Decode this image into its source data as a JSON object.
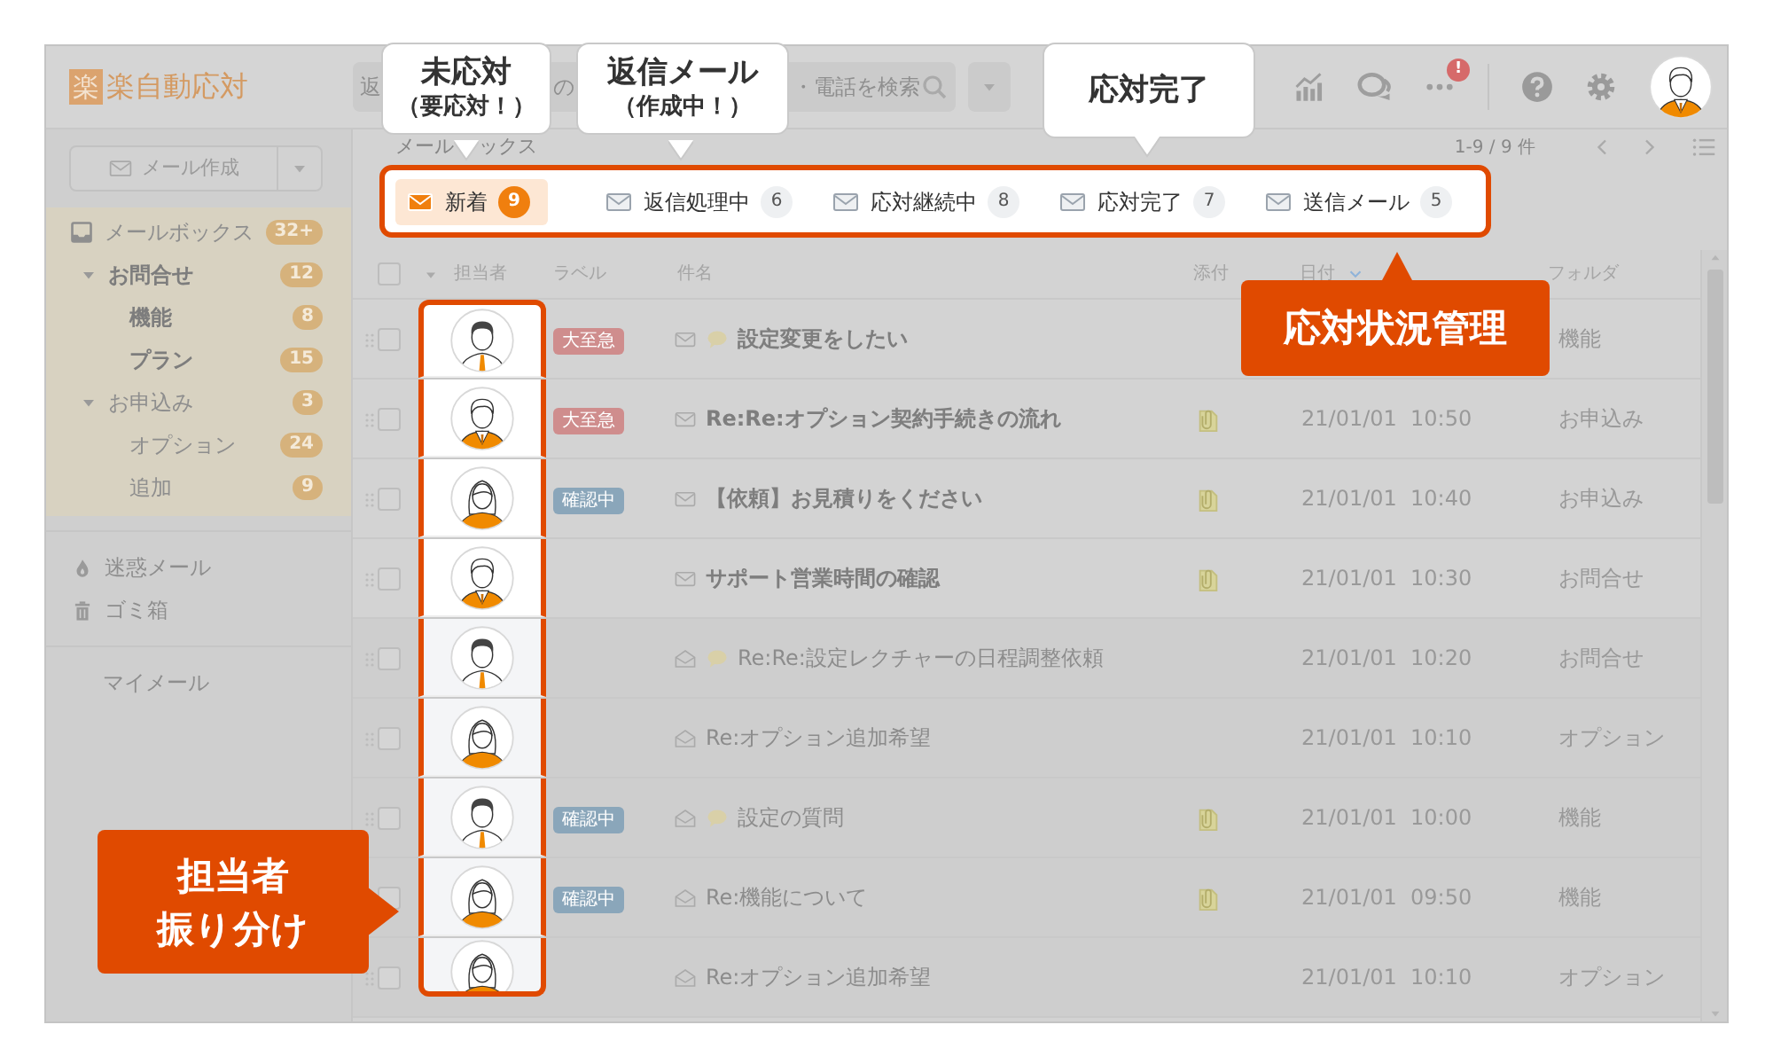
{
  "app": {
    "logo_mark": "楽",
    "logo_text": "楽自動応対"
  },
  "search": {
    "fragments": [
      "返",
      "の",
      "・電話を検索"
    ]
  },
  "header": {
    "alert_badge": "!"
  },
  "sidebar": {
    "compose": "メール作成",
    "mailbox": {
      "label": "メールボックス",
      "count": "32+",
      "selected": true,
      "children": [
        {
          "label": "お問合せ",
          "count": "12",
          "unread": true,
          "expanded": true,
          "children": [
            {
              "label": "機能",
              "count": "8",
              "unread": true
            },
            {
              "label": "プラン",
              "count": "15",
              "unread": true
            }
          ]
        },
        {
          "label": "お申込み",
          "count": "3",
          "unread": false,
          "expanded": true,
          "children": [
            {
              "label": "オプション",
              "count": "24",
              "unread": false
            },
            {
              "label": "追加",
              "count": "9",
              "unread": false
            }
          ]
        }
      ]
    },
    "others": [
      {
        "kind": "spam",
        "label": "迷惑メール"
      },
      {
        "kind": "trash",
        "label": "ゴミ箱"
      }
    ],
    "my_mail": "マイメール"
  },
  "breadcrumb": [
    "メール",
    "ックス"
  ],
  "pager": "1-9 / 9 件",
  "tabs": [
    {
      "label": "新着",
      "count": "9",
      "selected": true
    },
    {
      "label": "返信処理中",
      "count": "6",
      "selected": false
    },
    {
      "label": "応対継続中",
      "count": "8",
      "selected": false
    },
    {
      "label": "応対完了",
      "count": "7",
      "selected": false
    },
    {
      "label": "送信メール",
      "count": "5",
      "selected": false
    }
  ],
  "table": {
    "select_all": {
      "checked": false
    },
    "columns": [
      {
        "label": "担当者",
        "sorted": false
      },
      {
        "label": "ラベル",
        "sorted": false
      },
      {
        "label": "件名",
        "sorted": false
      },
      {
        "label": "添付",
        "sorted": false
      },
      {
        "label": "日付",
        "sorted": true
      },
      {
        "label": "フォルダ",
        "sorted": false
      }
    ],
    "rows": [
      {
        "checked": false,
        "assignee": {
          "kind": "man"
        },
        "label": {
          "text": "大至急",
          "kind": "urgent"
        },
        "read": false,
        "comment": true,
        "subject": "設定変更をしたい",
        "attachment": false,
        "folder": "機能"
      },
      {
        "checked": false,
        "assignee": {
          "kind": "suit"
        },
        "label": {
          "text": "大至急",
          "kind": "urgent"
        },
        "read": false,
        "comment": false,
        "subject": "Re:Re:オプション契約手続きの流れ",
        "attachment": true,
        "date": "21/01/01  10:50",
        "folder": "お申込み"
      },
      {
        "checked": false,
        "assignee": {
          "kind": "woman"
        },
        "label": {
          "text": "確認中",
          "kind": "checking"
        },
        "read": false,
        "comment": false,
        "subject": "【依頼】お見積りをください",
        "attachment": true,
        "date": "21/01/01  10:40",
        "folder": "お申込み"
      },
      {
        "checked": false,
        "assignee": {
          "kind": "suit"
        },
        "read": false,
        "comment": false,
        "subject": "サポート営業時間の確認",
        "attachment": true,
        "date": "21/01/01  10:30",
        "folder": "お問合せ"
      },
      {
        "checked": false,
        "assignee": {
          "kind": "man"
        },
        "read": true,
        "comment": true,
        "subject": "Re:Re:設定レクチャーの日程調整依頼",
        "attachment": false,
        "date": "21/01/01  10:20",
        "folder": "お問合せ"
      },
      {
        "checked": false,
        "assignee": {
          "kind": "woman"
        },
        "read": true,
        "comment": false,
        "subject": "Re:オプション追加希望",
        "attachment": false,
        "date": "21/01/01  10:10",
        "folder": "オプション"
      },
      {
        "checked": false,
        "assignee": {
          "kind": "man"
        },
        "label": {
          "text": "確認中",
          "kind": "checking"
        },
        "read": true,
        "comment": true,
        "subject": "設定の質問",
        "attachment": true,
        "date": "21/01/01  10:00",
        "folder": "機能"
      },
      {
        "checked": false,
        "assignee": {
          "kind": "woman"
        },
        "label": {
          "text": "確認中",
          "kind": "checking"
        },
        "read": true,
        "comment": false,
        "subject": "Re:機能について",
        "attachment": true,
        "date": "21/01/01  09:50",
        "folder": "機能"
      },
      {
        "checked": false,
        "assignee": {
          "kind": "woman"
        },
        "read": true,
        "comment": false,
        "subject": "Re:オプション追加希望",
        "attachment": false,
        "date": "21/01/01  10:10",
        "folder": "オプション"
      }
    ]
  },
  "callouts": [
    {
      "kind": "note",
      "lines": [
        {
          "text": "未応対",
          "kind": "heading"
        },
        {
          "text": "（要応対！）",
          "kind": "sub"
        }
      ]
    },
    {
      "kind": "note",
      "lines": [
        {
          "text": "返信メール",
          "kind": "heading"
        },
        {
          "text": "（作成中！）",
          "kind": "sub"
        }
      ]
    },
    {
      "kind": "note",
      "lines": [
        {
          "text": "応対完了",
          "kind": "heading"
        }
      ]
    },
    {
      "kind": "accent",
      "lines": [
        {
          "text": "応対状況管理",
          "kind": "heading"
        }
      ]
    },
    {
      "kind": "accent",
      "lines": [
        {
          "text": "担当者",
          "kind": "heading"
        },
        {
          "text": "振り分け",
          "kind": "heading"
        }
      ]
    }
  ]
}
